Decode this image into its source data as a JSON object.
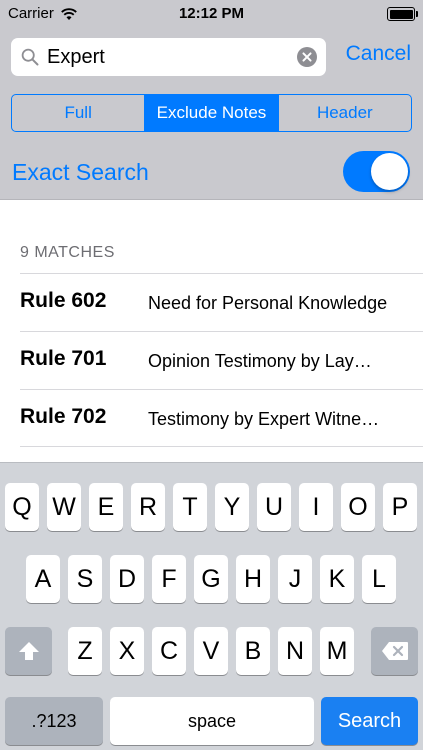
{
  "status": {
    "carrier": "Carrier",
    "time": "12:12 PM"
  },
  "search": {
    "value": "Expert",
    "cancel_label": "Cancel"
  },
  "segments": [
    "Full",
    "Exclude Notes",
    "Header"
  ],
  "exact_search": {
    "label": "Exact Search",
    "enabled": true
  },
  "results": {
    "header": "9 MATCHES",
    "rows": [
      {
        "rule": "Rule 602",
        "desc": "Need for Personal Knowledge"
      },
      {
        "rule": "Rule 701",
        "desc": "Opinion Testimony by Lay…"
      },
      {
        "rule": "Rule 702",
        "desc": "Testimony by Expert Witne…"
      }
    ]
  },
  "keyboard": {
    "row1": [
      "Q",
      "W",
      "E",
      "R",
      "T",
      "Y",
      "U",
      "I",
      "O",
      "P"
    ],
    "row2": [
      "A",
      "S",
      "D",
      "F",
      "G",
      "H",
      "J",
      "K",
      "L"
    ],
    "row3": [
      "Z",
      "X",
      "C",
      "V",
      "B",
      "N",
      "M"
    ],
    "numbers_label": ".?123",
    "space_label": "space",
    "search_label": "Search"
  },
  "colors": {
    "accent": "#007aff",
    "header_bg": "#c9c9ce",
    "keyboard_bg": "#d1d4d9",
    "search_key": "#1a80f2"
  }
}
